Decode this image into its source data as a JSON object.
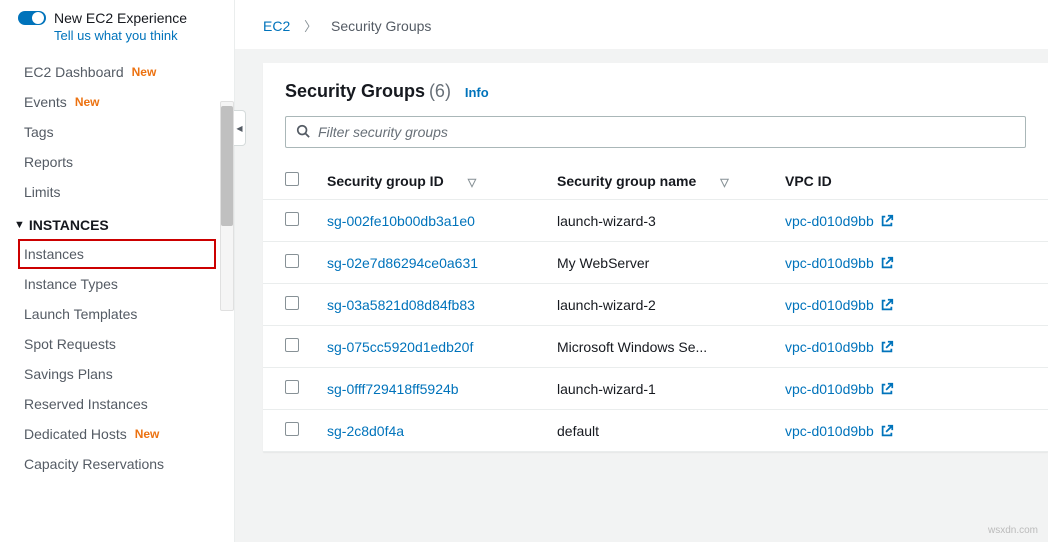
{
  "sidebar": {
    "toggle_label": "New EC2 Experience",
    "feedback": "Tell us what you think",
    "top_items": [
      {
        "label": "EC2 Dashboard",
        "new": true
      },
      {
        "label": "Events",
        "new": true
      },
      {
        "label": "Tags",
        "new": false
      },
      {
        "label": "Reports",
        "new": false
      },
      {
        "label": "Limits",
        "new": false
      }
    ],
    "section": "INSTANCES",
    "instances_items": [
      {
        "label": "Instances",
        "highlighted": true
      },
      {
        "label": "Instance Types"
      },
      {
        "label": "Launch Templates"
      },
      {
        "label": "Spot Requests"
      },
      {
        "label": "Savings Plans"
      },
      {
        "label": "Reserved Instances"
      },
      {
        "label": "Dedicated Hosts",
        "new": true
      },
      {
        "label": "Capacity Reservations"
      }
    ]
  },
  "breadcrumb": {
    "root": "EC2",
    "current": "Security Groups"
  },
  "panel": {
    "title": "Security Groups",
    "count": "(6)",
    "info": "Info",
    "filter_placeholder": "Filter security groups"
  },
  "columns": {
    "id": "Security group ID",
    "name": "Security group name",
    "vpc": "VPC ID"
  },
  "rows": [
    {
      "id": "sg-002fe10b00db3a1e0",
      "name": "launch-wizard-3",
      "vpc": "vpc-d010d9bb"
    },
    {
      "id": "sg-02e7d86294ce0a631",
      "name": "My WebServer",
      "vpc": "vpc-d010d9bb"
    },
    {
      "id": "sg-03a5821d08d84fb83",
      "name": "launch-wizard-2",
      "vpc": "vpc-d010d9bb"
    },
    {
      "id": "sg-075cc5920d1edb20f",
      "name": "Microsoft Windows Se...",
      "vpc": "vpc-d010d9bb"
    },
    {
      "id": "sg-0fff729418ff5924b",
      "name": "launch-wizard-1",
      "vpc": "vpc-d010d9bb"
    },
    {
      "id": "sg-2c8d0f4a",
      "name": "default",
      "vpc": "vpc-d010d9bb"
    }
  ],
  "watermark": "wsxdn.com"
}
